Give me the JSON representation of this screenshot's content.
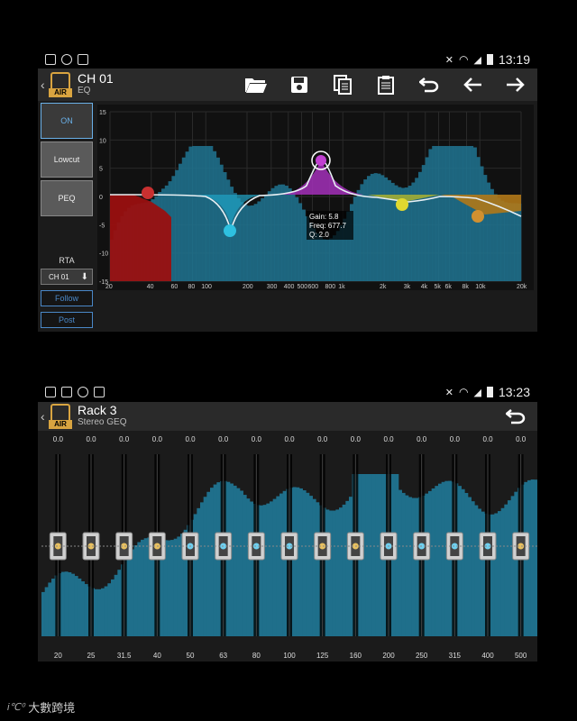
{
  "screen1": {
    "status": {
      "time": "13:19"
    },
    "appbar": {
      "title": "CH 01",
      "subtitle": "EQ",
      "logo_text": "AIR"
    },
    "toolbar_icons": [
      "folder-open-icon",
      "save-icon",
      "copy-icon",
      "paste-icon",
      "undo-icon",
      "arrow-left-icon",
      "arrow-right-icon"
    ],
    "side": {
      "on_label": "ON",
      "lowcut_label": "Lowcut",
      "peq_label": "PEQ",
      "rta_label": "RTA",
      "rta_value": "CH 01",
      "follow_label": "Follow",
      "post_label": "Post"
    },
    "graph": {
      "y_ticks": [
        "15",
        "10",
        "5",
        "0",
        "-5",
        "-10",
        "-15"
      ],
      "x_ticks": [
        "20",
        "40",
        "60",
        "80",
        "100",
        "200",
        "300",
        "400",
        "500",
        "600",
        "800",
        "1k",
        "2k",
        "3k",
        "4k",
        "5k",
        "6k",
        "8k",
        "10k",
        "20k"
      ],
      "tooltip": {
        "gain": "Gain: 5.8",
        "freq": "Freq: 677.7",
        "q": "Q: 2.0"
      }
    }
  },
  "screen2": {
    "status": {
      "time": "13:23"
    },
    "appbar": {
      "title": "Rack 3",
      "subtitle": "Stereo GEQ",
      "logo_text": "AIR"
    },
    "undo_icon": "undo-icon",
    "bands": [
      {
        "freq": "20",
        "gain": "0.0"
      },
      {
        "freq": "25",
        "gain": "0.0"
      },
      {
        "freq": "31.5",
        "gain": "0.0"
      },
      {
        "freq": "40",
        "gain": "0.0"
      },
      {
        "freq": "50",
        "gain": "0.0"
      },
      {
        "freq": "63",
        "gain": "0.0"
      },
      {
        "freq": "80",
        "gain": "0.0"
      },
      {
        "freq": "100",
        "gain": "0.0"
      },
      {
        "freq": "125",
        "gain": "0.0"
      },
      {
        "freq": "160",
        "gain": "0.0"
      },
      {
        "freq": "200",
        "gain": "0.0"
      },
      {
        "freq": "250",
        "gain": "0.0"
      },
      {
        "freq": "315",
        "gain": "0.0"
      },
      {
        "freq": "400",
        "gain": "0.0"
      },
      {
        "freq": "500",
        "gain": "0.0"
      }
    ]
  },
  "footer": {
    "brand": "大數跨境",
    "mark": "i℃⁰"
  },
  "colors": {
    "accent": "#d9a440",
    "rta": "#1f6f8b",
    "button_blue": "#4a88c8"
  }
}
